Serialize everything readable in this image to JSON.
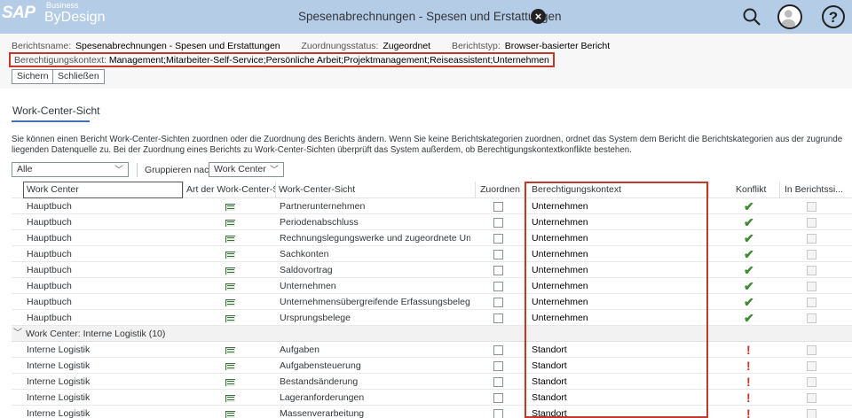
{
  "shell": {
    "logo_sap": "SAP",
    "logo_business": "Business",
    "logo_bydesign": "ByDesign",
    "title": "Spesenabrechnungen - Spesen und Erstattungen"
  },
  "header": {
    "report_name_label": "Berichtsname:",
    "report_name_value": "Spesenabrechnungen - Spesen und Erstattungen",
    "assign_status_label": "Zuordnungsstatus:",
    "assign_status_value": "Zugeordnet",
    "report_type_label": "Berichtstyp:",
    "report_type_value": "Browser-basierter Bericht",
    "context_label": "Berechtigungskontext:",
    "context_value": "Management;Mitarbeiter-Self-Service;Persönliche Arbeit;Projektmanagement;Reiseassistent;Unternehmen"
  },
  "toolbar": {
    "save_label": "Sichern",
    "close_label": "Schließen"
  },
  "section": {
    "tab_label": "Work-Center-Sicht",
    "description": "Sie können einen Bericht Work-Center-Sichten zuordnen oder die Zuordnung des Berichts ändern. Wenn Sie keine Berichtskategorien zuordnen, ordnet das System dem Bericht die Berichtskategorien aus der zugrunde liegenden Datenquelle zu. Bei der Zuordnung eines Berichts zu Work-Center-Sichten überprüft das System außerdem, ob Berechtigungskontextkonflikte bestehen."
  },
  "filter": {
    "selected": "Alle",
    "group_label": "Gruppieren nach",
    "group_selected": "Work Center"
  },
  "table": {
    "columns": {
      "work_center": "Work Center",
      "view_type": "Art der Work-Center-S...",
      "view": "Work-Center-Sicht",
      "assign": "Zuordnen",
      "context": "Berechtigungskontext",
      "conflict": "Konflikt",
      "in_report": "In Berichtssi..."
    },
    "group_label": "Work Center: Interne Logistik (10)",
    "rows_a": [
      {
        "wc": "Hauptbuch",
        "view": "Partnerunternehmen",
        "ctx": "Unternehmen",
        "conflict": "ok"
      },
      {
        "wc": "Hauptbuch",
        "view": "Periodenabschluss",
        "ctx": "Unternehmen",
        "conflict": "ok"
      },
      {
        "wc": "Hauptbuch",
        "view": "Rechnungslegungswerke und zugeordnete Unter...",
        "ctx": "Unternehmen",
        "conflict": "ok"
      },
      {
        "wc": "Hauptbuch",
        "view": "Sachkonten",
        "ctx": "Unternehmen",
        "conflict": "ok"
      },
      {
        "wc": "Hauptbuch",
        "view": "Saldovortrag",
        "ctx": "Unternehmen",
        "conflict": "ok"
      },
      {
        "wc": "Hauptbuch",
        "view": "Unternehmen",
        "ctx": "Unternehmen",
        "conflict": "ok"
      },
      {
        "wc": "Hauptbuch",
        "view": "Unternehmensübergreifende Erfassungsbelege",
        "ctx": "Unternehmen",
        "conflict": "ok"
      },
      {
        "wc": "Hauptbuch",
        "view": "Ursprungsbelege",
        "ctx": "Unternehmen",
        "conflict": "ok"
      }
    ],
    "rows_b": [
      {
        "wc": "Interne Logistik",
        "view": "Aufgaben",
        "ctx": "Standort",
        "conflict": "!"
      },
      {
        "wc": "Interne Logistik",
        "view": "Aufgabensteuerung",
        "ctx": "Standort",
        "conflict": "!"
      },
      {
        "wc": "Interne Logistik",
        "view": "Bestandsänderung",
        "ctx": "Standort",
        "conflict": "!"
      },
      {
        "wc": "Interne Logistik",
        "view": "Lageranforderungen",
        "ctx": "Standort",
        "conflict": "!"
      },
      {
        "wc": "Interne Logistik",
        "view": "Massenverarbeitung",
        "ctx": "Standort",
        "conflict": "!"
      }
    ]
  }
}
